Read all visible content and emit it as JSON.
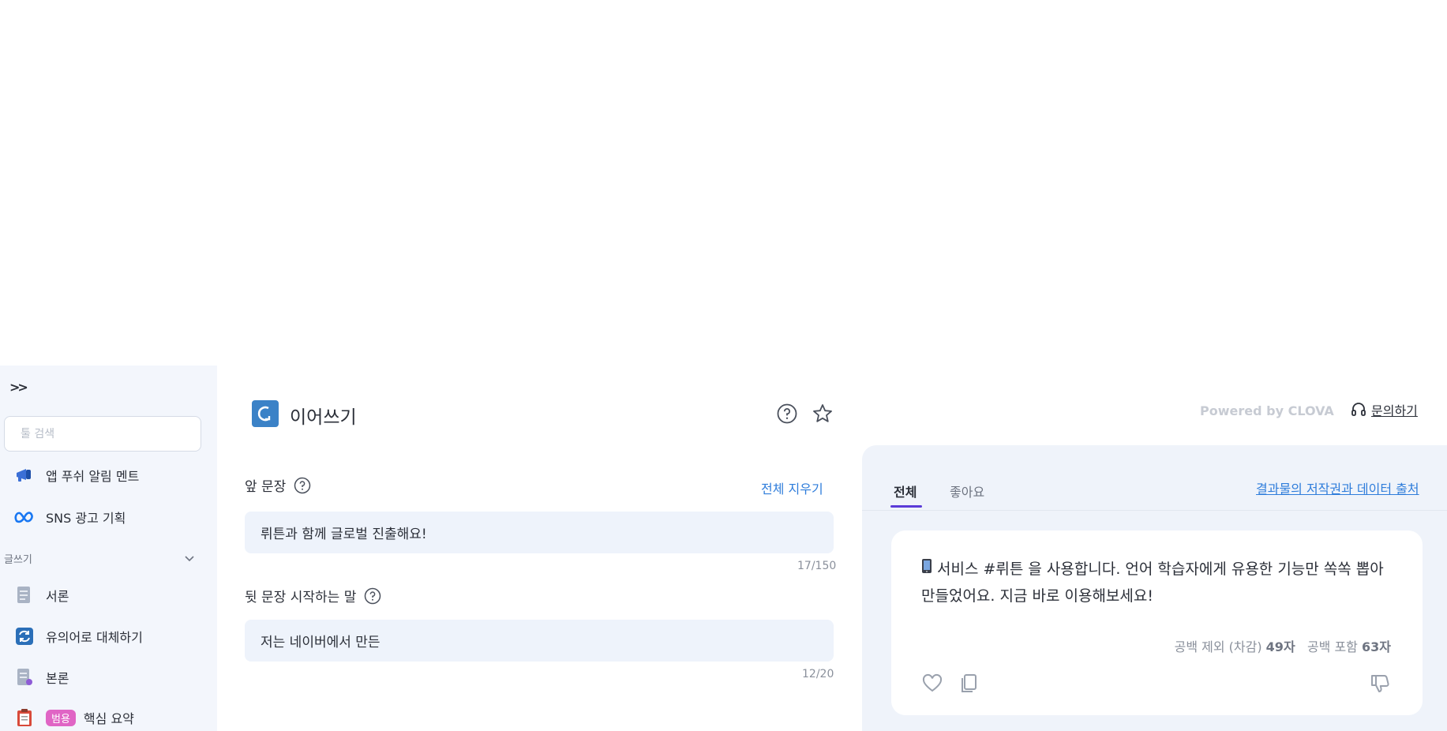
{
  "sidebar": {
    "expand_label": ">>",
    "search_placeholder": "툴 검색",
    "items_top": [
      {
        "label": "앱 푸쉬 알림 멘트",
        "icon": "megaphone-icon"
      },
      {
        "label": "SNS 광고 기획",
        "icon": "meta-logo-icon"
      }
    ],
    "section_label": "글쓰기",
    "items_section": [
      {
        "label": "서론",
        "icon": "document-icon"
      },
      {
        "label": "유의어로 대체하기",
        "icon": "refresh-icon"
      },
      {
        "label": "본론",
        "icon": "document-edit-icon"
      },
      {
        "label": "핵심 요약",
        "icon": "clipboard-icon",
        "badge": "범용"
      }
    ]
  },
  "header": {
    "title": "이어쓰기",
    "powered_by": "Powered by CLOVA",
    "contact_label": "문의하기"
  },
  "form": {
    "front_label": "앞 문장",
    "clear_all": "전체 지우기",
    "front_value": "뤼튼과 함께 글로벌 진출해요!",
    "front_count": "17/150",
    "next_label": "뒷 문장 시작하는 말",
    "next_value": "저는 네이버에서 만든",
    "next_count": "12/20"
  },
  "result": {
    "tabs": [
      "전체",
      "좋아요"
    ],
    "copyright_link": "결과물의 저작권과 데이터 출처",
    "card_text": "서비스 #뤼튼 을 사용합니다. 언어 학습자에게 유용한 기능만 쏙쏙 뽑아 만들었어요. 지금 바로 이용해보세요!",
    "count_no_space_label": "공백 제외 (차감)",
    "count_no_space": "49자",
    "count_with_space_label": "공백 포함",
    "count_with_space": "63자"
  },
  "colors": {
    "accent": "#2f7ddb",
    "tab_underline": "#5b3bd8",
    "sidebar_bg": "#f3f6fc",
    "badge": "#e065c5",
    "tool_icon": "#3b82c7"
  }
}
